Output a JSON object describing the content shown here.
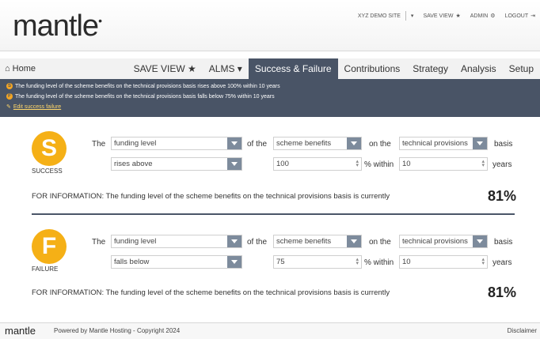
{
  "header": {
    "logo": "mantle",
    "logo_mark": "•",
    "site": "XYZ DEMO SITE",
    "save_view": "SAVE VIEW",
    "admin": "ADMIN",
    "logout": "LOGOUT"
  },
  "nav": {
    "home": "Home",
    "tabs": [
      {
        "label": "SAVE VIEW ★"
      },
      {
        "label": "ALMS ▾"
      },
      {
        "label": "Success & Failure"
      },
      {
        "label": "Contributions"
      },
      {
        "label": "Strategy"
      },
      {
        "label": "Analysis"
      },
      {
        "label": "Setup"
      }
    ]
  },
  "banner": {
    "s_letter": "S",
    "f_letter": "F",
    "success_line": "The funding level of the scheme benefits on the technical provisions basis rises above 100% within 10 years",
    "failure_line": "The funding level of the scheme benefits on the technical provisions basis falls below 75% within 10 years",
    "edit_link": "Edit success failure"
  },
  "success": {
    "letter": "S",
    "caption": "SUCCESS",
    "the": "The",
    "metric": "funding level",
    "of_the": "of the",
    "scope": "scheme benefits",
    "on_the": "on the",
    "basis_value": "technical provisions",
    "basis": "basis",
    "direction": "rises above",
    "threshold": "100",
    "pct_within": "% within",
    "years_value": "10",
    "years": "years",
    "info": "FOR INFORMATION: The funding level of the scheme benefits on the technical provisions basis is currently",
    "current": "81%"
  },
  "failure": {
    "letter": "F",
    "caption": "FAILURE",
    "the": "The",
    "metric": "funding level",
    "of_the": "of the",
    "scope": "scheme benefits",
    "on_the": "on the",
    "basis_value": "technical provisions",
    "basis": "basis",
    "direction": "falls below",
    "threshold": "75",
    "pct_within": "% within",
    "years_value": "10",
    "years": "years",
    "info": "FOR INFORMATION: The funding level of the scheme benefits on the technical provisions basis is currently",
    "current": "81%"
  },
  "footer": {
    "logo": "mantle",
    "powered": "Powered by Mantle Hosting - Copyright 2024",
    "disclaimer": "Disclaimer"
  },
  "colors": {
    "accent": "#495466",
    "badge": "#f5b016",
    "link": "#ffd76a"
  }
}
